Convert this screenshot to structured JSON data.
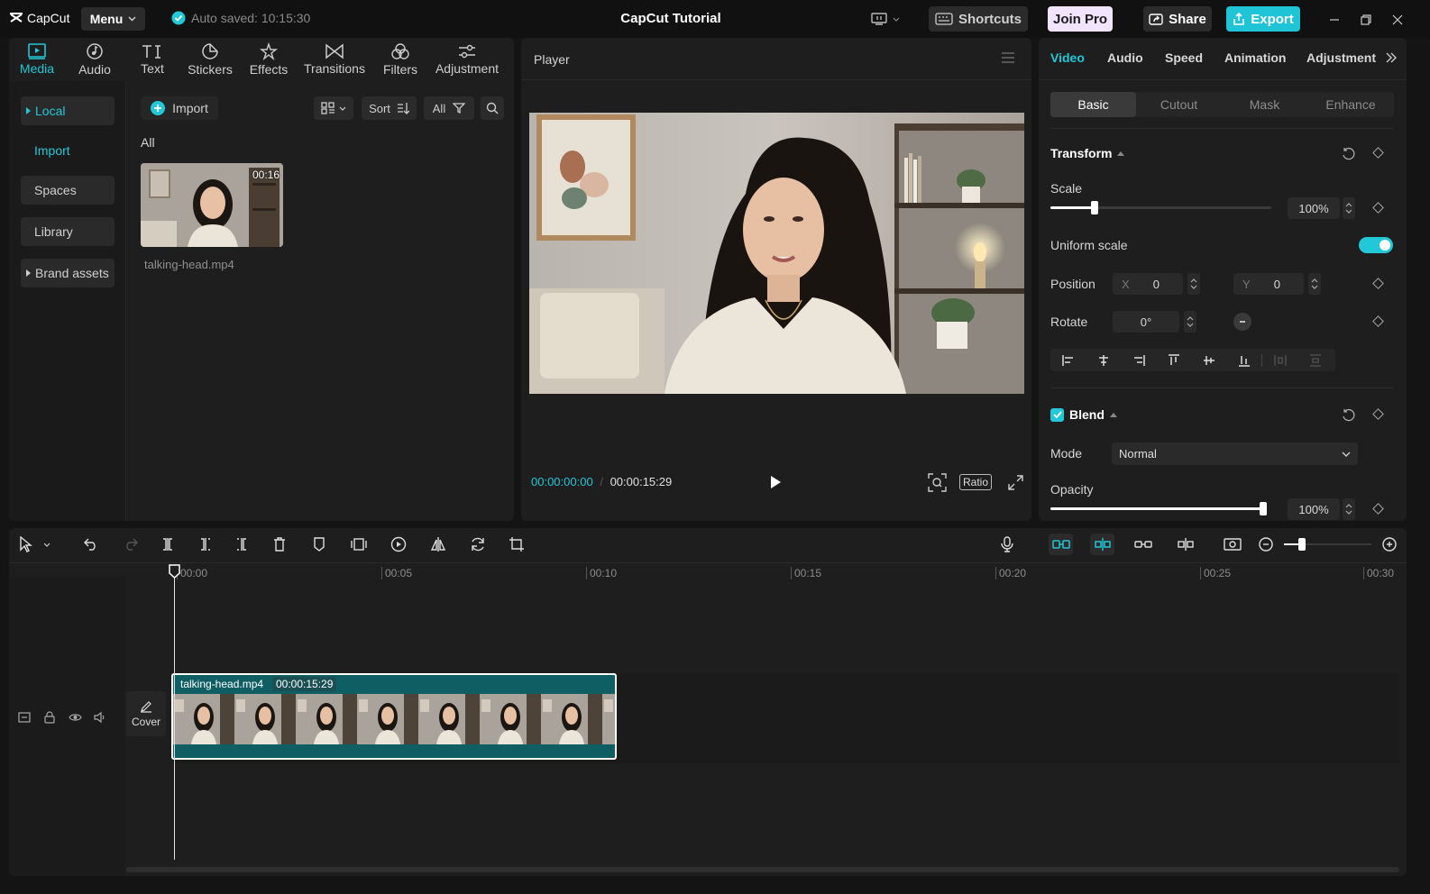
{
  "titlebar": {
    "logo": "CapCut",
    "menu_label": "Menu",
    "autosave": "Auto saved: 10:15:30",
    "title": "CapCut Tutorial",
    "shortcuts": "Shortcuts",
    "join_pro": "Join Pro",
    "share": "Share",
    "export": "Export"
  },
  "media_tabs": [
    {
      "label": "Media",
      "icon": "media-icon"
    },
    {
      "label": "Audio",
      "icon": "audio-icon"
    },
    {
      "label": "Text",
      "icon": "text-icon"
    },
    {
      "label": "Stickers",
      "icon": "stickers-icon"
    },
    {
      "label": "Effects",
      "icon": "effects-icon"
    },
    {
      "label": "Transitions",
      "icon": "transitions-icon"
    },
    {
      "label": "Filters",
      "icon": "filters-icon"
    },
    {
      "label": "Adjustment",
      "icon": "adjustment-icon"
    }
  ],
  "side_nav": {
    "local": "Local",
    "import": "Import",
    "spaces": "Spaces",
    "library": "Library",
    "brand_assets": "Brand assets"
  },
  "media_toolbar": {
    "import": "Import",
    "sort": "Sort",
    "all": "All",
    "section_label": "All"
  },
  "media_item": {
    "duration": "00:16",
    "filename": "talking-head.mp4"
  },
  "player": {
    "title": "Player",
    "current_time": "00:00:00:00",
    "total_time": "00:00:15:29",
    "ratio": "Ratio"
  },
  "right_panel": {
    "tabs": [
      "Video",
      "Audio",
      "Speed",
      "Animation",
      "Adjustment"
    ],
    "subtabs": [
      "Basic",
      "Cutout",
      "Mask",
      "Enhance"
    ],
    "transform": "Transform",
    "scale_label": "Scale",
    "scale_value": "100%",
    "scale_fraction": 0.2,
    "uniform_scale": "Uniform scale",
    "uniform_scale_on": true,
    "position_label": "Position",
    "pos_x_label": "X",
    "pos_x": "0",
    "pos_y_label": "Y",
    "pos_y": "0",
    "rotate_label": "Rotate",
    "rotate_value": "0°",
    "blend": "Blend",
    "mode_label": "Mode",
    "mode_value": "Normal",
    "opacity_label": "Opacity",
    "opacity_value": "100%",
    "opacity_fraction": 1.0
  },
  "timeline": {
    "ruler": [
      "00:00",
      "00:05",
      "00:10",
      "00:15",
      "00:20",
      "00:25",
      "00:30"
    ],
    "cover_label": "Cover",
    "clip_name": "talking-head.mp4",
    "clip_duration": "00:00:15:29"
  },
  "colors": {
    "accent": "#22c8d8",
    "export_bg": "#1fc4d6",
    "join_pro_bg": "#f0e4ff",
    "clip_bg": "#0f5e63"
  }
}
